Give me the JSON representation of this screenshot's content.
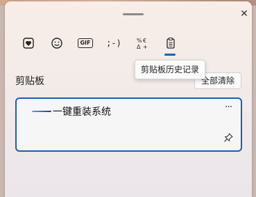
{
  "panel": {
    "close_icon": "close-icon",
    "tabs": [
      {
        "name": "emoji-heart-icon"
      },
      {
        "name": "smiley-icon"
      },
      {
        "name": "gif-icon",
        "label": "GIF"
      },
      {
        "name": "kaomoji-icon",
        "label": ";-)"
      },
      {
        "name": "symbols-icon"
      },
      {
        "name": "clipboard-icon",
        "selected": true
      }
    ],
    "tooltip": "剪贴板历史记录",
    "section_title": "剪贴板",
    "clear_all_label": "全部清除",
    "clipboard_items": [
      {
        "text": "一键重装系统",
        "more_icon": "more-dots-icon",
        "pin_icon": "pin-icon"
      }
    ],
    "accent_color": "#1a5fb4"
  }
}
